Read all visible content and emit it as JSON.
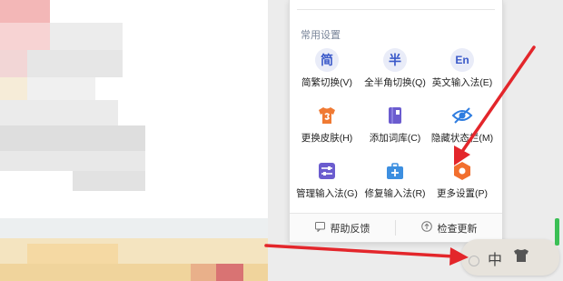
{
  "popup": {
    "section_title": "常用设置",
    "items": [
      {
        "label": "简繁切换(V)",
        "icon_text": "简",
        "icon": "simplified-traditional-icon"
      },
      {
        "label": "全半角切换(Q)",
        "icon_text": "半",
        "icon": "half-width-icon"
      },
      {
        "label": "英文输入法(E)",
        "icon_text": "En",
        "icon": "english-input-icon"
      },
      {
        "label": "更换皮肤(H)",
        "icon": "skin-shirt-icon",
        "color": "#f07a33"
      },
      {
        "label": "添加词库(C)",
        "icon": "dictionary-icon",
        "color": "#6b5ccf"
      },
      {
        "label": "隐藏状态栏(M)",
        "icon": "hide-eye-icon",
        "color": "#2f7de0"
      },
      {
        "label": "管理输入法(G)",
        "icon": "manage-input-icon",
        "color": "#6b5ccf"
      },
      {
        "label": "修复输入法(R)",
        "icon": "repair-toolbox-icon",
        "color": "#3d8fe0"
      },
      {
        "label": "更多设置(P)",
        "icon": "more-settings-hex-icon",
        "color": "#f26f2e"
      }
    ],
    "footer": {
      "help_label": "帮助反馈",
      "update_label": "检查更新"
    }
  },
  "ime_bar": {
    "lang_label": "中"
  },
  "colors": {
    "arrow": "#e3262b",
    "accent": "#3a59c9"
  }
}
